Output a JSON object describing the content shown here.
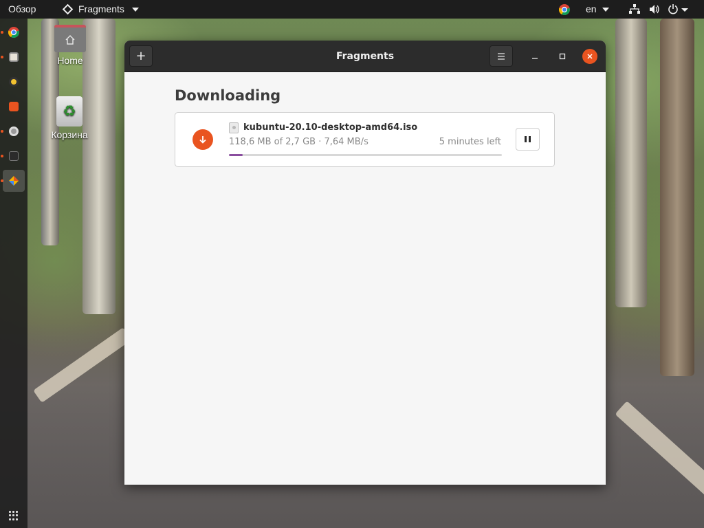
{
  "topbar": {
    "activities_label": "Обзор",
    "app_menu_label": "Fragments",
    "language_label": "en"
  },
  "desktop": {
    "home_label": "Home",
    "trash_label": "Корзина"
  },
  "window": {
    "title": "Fragments",
    "add_button_label": "+",
    "menu_icon": "hamburger-menu-icon"
  },
  "downloads": {
    "section_title": "Downloading",
    "items": [
      {
        "file_name": "kubuntu-20.10-desktop-amd64.iso",
        "progress_text": "118,6 MB of 2,7 GB · 7,64 MB/s",
        "eta": "5 minutes left",
        "progress_fraction": 0.05
      }
    ]
  },
  "colors": {
    "accent": "#e95420",
    "progress": "#8a4d9f",
    "headerbar": "#2c2c2c",
    "topbar": "#1d1d1d"
  }
}
